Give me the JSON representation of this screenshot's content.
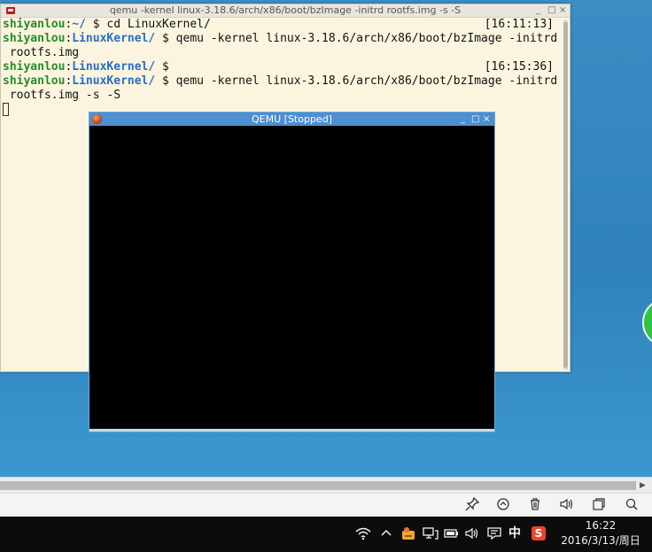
{
  "terminal": {
    "title": "qemu -kernel linux-3.18.6/arch/x86/boot/bzImage -initrd rootfs.img -s -S",
    "controls": [
      "_",
      "□",
      "×"
    ],
    "lines": [
      {
        "user": "shiyanlou",
        "sep": ":",
        "path": "~/",
        "cmd": " $ cd LinuxKernel/",
        "time": "[16:11:13]"
      },
      {
        "user": "shiyanlou",
        "sep": ":",
        "path": "LinuxKernel/",
        "cmd": " $ qemu -kernel linux-3.18.6/arch/x86/boot/bzImage -initrd"
      },
      {
        "cont": " rootfs.img"
      },
      {
        "user": "shiyanlou",
        "sep": ":",
        "path": "LinuxKernel/",
        "cmd": " $",
        "time": "[16:15:36]"
      },
      {
        "user": "shiyanlou",
        "sep": ":",
        "path": "LinuxKernel/",
        "cmd": " $ qemu -kernel linux-3.18.6/arch/x86/boot/bzImage -initrd"
      },
      {
        "cont": " rootfs.img -s -S"
      }
    ]
  },
  "qemu": {
    "title": "QEMU [Stopped]",
    "controls": [
      "_",
      "□",
      "×"
    ]
  },
  "host_toolbar": {
    "icons": [
      "pin-icon",
      "refresh-icon",
      "trash-icon",
      "volume-icon",
      "window-icon",
      "search-icon"
    ]
  },
  "taskbar": {
    "ime_label": "中",
    "sogou_label": "S",
    "clock_time": "16:22",
    "clock_date": "2016/3/13/周日"
  },
  "colors": {
    "terminal_bg": "#fbf5df",
    "prompt_user": "#2a8a2a",
    "prompt_path": "#2a6dc4",
    "qemu_titlebar": "#4d8fd0",
    "desktop": "#2f82bb",
    "taskbar": "#0c0c0c"
  }
}
